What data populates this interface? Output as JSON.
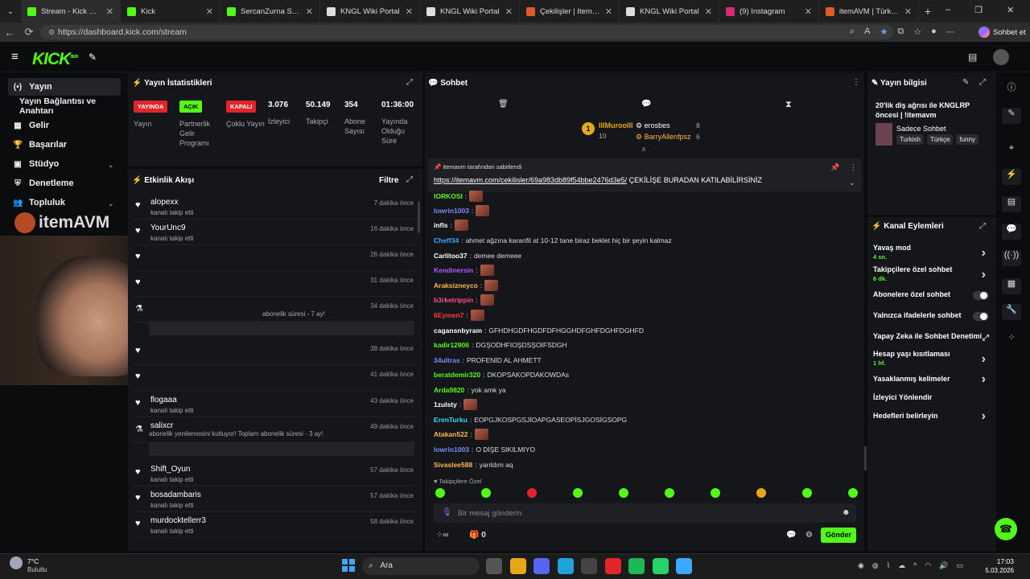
{
  "browser": {
    "tabs": [
      {
        "title": "Stream - Kick Dashboar",
        "color": "#53fc18"
      },
      {
        "title": "Kick",
        "color": "#53fc18"
      },
      {
        "title": "SercanZurna Stream - W",
        "color": "#53fc18"
      },
      {
        "title": "KNGL Wiki Portal",
        "color": "#dddddd"
      },
      {
        "title": "KNGL Wiki Portal",
        "color": "#dddddd"
      },
      {
        "title": "Çekilişler | ItemAVM",
        "color": "#e05a2b"
      },
      {
        "title": "KNGL Wiki Portal",
        "color": "#dddddd"
      },
      {
        "title": "(9) Instagram",
        "color": "#d62976"
      },
      {
        "title": "itemAVM | Türkiye'nin #",
        "color": "#e05a2b"
      }
    ],
    "url": "https://dashboard.kick.com/stream",
    "profile_label": "Sohbet et"
  },
  "header": {
    "logo": "KICK",
    "beta": "BETA"
  },
  "sidebar": {
    "items": [
      {
        "label": "Yayın",
        "icon": "(•)"
      },
      {
        "label": "Yayın Bağlantısı ve Anahtarı",
        "icon": ""
      },
      {
        "label": "Gelir",
        "icon": "▦"
      },
      {
        "label": "Başarılar",
        "icon": "🏆"
      },
      {
        "label": "Stüdyo",
        "icon": "▣"
      },
      {
        "label": "Denetleme",
        "icon": "⛨"
      },
      {
        "label": "Topluluk",
        "icon": "👥"
      }
    ],
    "overlay_text": "itemAVM"
  },
  "stats": {
    "title": "Yayın İstatistikleri",
    "badges": [
      {
        "badge": "YAYINDA",
        "label": "Yayın",
        "color": "#e0262a"
      },
      {
        "badge": "AÇIK",
        "label": "Partnerlik Gelir Programı",
        "color": "#53fc18"
      },
      {
        "badge": "KAPALI",
        "label": "Çoklu Yayın",
        "color": "#e0262a"
      }
    ],
    "values": [
      {
        "value": "3.076",
        "label": "İzleyici"
      },
      {
        "value": "50.149",
        "label": "Takipçi"
      },
      {
        "value": "354",
        "label": "Abone Sayısı"
      },
      {
        "value": "01:36:00",
        "label": "Yayında Olduğu Süre"
      }
    ]
  },
  "activity": {
    "title": "Etkinlik Akışı",
    "filter": "Filtre",
    "items": [
      {
        "name": "alopexx",
        "sub": "kanalı takip etti",
        "time": "7 dakika önce"
      },
      {
        "name": "YourUnc9",
        "sub": "kanalı takip etti",
        "time": "16 dakika önce"
      },
      {
        "name": "",
        "sub": "",
        "time": "26 dakika önce"
      },
      {
        "name": "",
        "sub": "",
        "time": "31 dakika önce"
      },
      {
        "name": "",
        "sub": "abonelik süresi - 7 ay!",
        "time": "34 dakika önce"
      },
      {
        "name": "",
        "sub": "",
        "time": "38 dakika önce"
      },
      {
        "name": "",
        "sub": "",
        "time": "41 dakika önce"
      },
      {
        "name": "flogaaa",
        "sub": "kanalı takip etti",
        "time": "43 dakika önce"
      },
      {
        "name": "salixcr",
        "sub": "abonelik yenilemesini kutluyor! Toplam abonelik süresi - 3 ay!",
        "time": "49 dakika önce"
      },
      {
        "name": "Shift_Oyun",
        "sub": "kanalı takip etti",
        "time": "57 dakika önce"
      },
      {
        "name": "bosadambaris",
        "sub": "kanalı takip etti",
        "time": "57 dakika önce"
      },
      {
        "name": "murdocktellerr3",
        "sub": "kanalı takip etti",
        "time": "58 dakika önce"
      }
    ]
  },
  "chat": {
    "title": "Sohbet",
    "top": [
      {
        "rank": "1",
        "name": "lIlMuroolll",
        "count": "10"
      },
      {
        "name": "erosbes",
        "count": "8"
      },
      {
        "name": "BarryAllenfpsz",
        "count": "6"
      }
    ],
    "pinned_by": "itemavm tarafından sabitlendi",
    "pinned_link": "https://itemavm.com/cekilisler/69a983db89f54bbe2476d3e5/",
    "pinned_text": "ÇEKİLİŞE BURADAN KATILABİLİRSİNİZ",
    "messages": [
      {
        "user": "IORKOSI",
        "color": "#53fc18",
        "text": "",
        "emote": true
      },
      {
        "user": "lowrin1003",
        "color": "#7b8cff",
        "text": "",
        "emote": true
      },
      {
        "user": "infls",
        "color": "#ffffff",
        "text": "",
        "emote": true
      },
      {
        "user": "Cheff34",
        "color": "#3aa9ff",
        "text": "ahmet ağzına karanfil at 10-12 tane biraz beklet hiç bir şeyin kalmaz",
        "emote": false
      },
      {
        "user": "Carlitoo37",
        "color": "#ffffff",
        "text": "demee demeee",
        "emote": false
      },
      {
        "user": "Kendinersin",
        "color": "#b05bff",
        "text": "",
        "emote": true
      },
      {
        "user": "Araksizneyco",
        "color": "#ffb84d",
        "text": "",
        "emote": true
      },
      {
        "user": "b3rketrippin",
        "color": "#ff4d8d",
        "text": "",
        "emote": true
      },
      {
        "user": "6Eymen7",
        "color": "#ff3b3b",
        "text": "",
        "emote": true
      },
      {
        "user": "cagansnbyram",
        "color": "#ffffff",
        "text": "GFHDHGDFHGDFDFHGGHDFGHFDGHFDGHFD",
        "emote": false
      },
      {
        "user": "kadir12906",
        "color": "#53fc18",
        "text": "DGŞODHFIOŞDSŞOIFSDGH",
        "emote": false
      },
      {
        "user": "34ultras",
        "color": "#7b8cff",
        "text": "PROFENİD AL AHMETT",
        "emote": false
      },
      {
        "user": "beratdemir320",
        "color": "#53fc18",
        "text": "DKOPSAKOPDAKOWDAs",
        "emote": false
      },
      {
        "user": "Arda9820",
        "color": "#53fc18",
        "text": "yok amk ya",
        "emote": false
      },
      {
        "user": "1zulsty",
        "color": "#ffffff",
        "text": "",
        "emote": true
      },
      {
        "user": "ErenTurku",
        "color": "#3ad6ff",
        "text": "EOPGJKOSPGSJİOAPGASEOPİSJGOSİGSOPG",
        "emote": false
      },
      {
        "user": "Atakan522",
        "color": "#ffb84d",
        "text": "",
        "emote": true
      },
      {
        "user": "lowrin1003",
        "color": "#7b8cff",
        "text": "O DİŞE SIKILMIYO",
        "emote": false
      },
      {
        "user": "Sivaslee588",
        "color": "#ffb84d",
        "text": "yarıldım aq",
        "emote": false
      }
    ],
    "followers_only": "Takipçilere Özel",
    "input_placeholder": "Bir mesaj gönderin",
    "send": "Gönder",
    "points": "0"
  },
  "info": {
    "title": "Yayın bilgisi",
    "stream_title": "20'lik diş ağrısı ile KNGLRP öncesi | !itemavm",
    "category": "Sadece Sohbet",
    "tags": [
      "Turkish",
      "Türkçe",
      "funny"
    ]
  },
  "actions": {
    "title": "Kanal Eylemleri",
    "items": [
      {
        "label": "Yavaş mod",
        "sub": "4 sn.",
        "kind": "chev"
      },
      {
        "label": "Takipçilere özel sohbet",
        "sub": "6 dk.",
        "kind": "chev"
      },
      {
        "label": "Abonelere özel sohbet",
        "sub": "",
        "kind": "toggle"
      },
      {
        "label": "Yalnızca ifadelerle sohbet",
        "sub": "",
        "kind": "toggle"
      },
      {
        "label": "Yapay Zeka ile Sohbet Denetimi",
        "sub": "",
        "kind": "ext"
      },
      {
        "label": "Hesap yaşı kısıtlaması",
        "sub": "1 hf.",
        "kind": "chev"
      },
      {
        "label": "Yasaklanmış kelimeler",
        "sub": "",
        "kind": "chev"
      },
      {
        "label": "İzleyici Yönlendir",
        "sub": "",
        "kind": "none"
      },
      {
        "label": "Hedefleri belirleyin",
        "sub": "",
        "kind": "chev"
      }
    ]
  },
  "taskbar": {
    "weather_temp": "7°C",
    "weather_text": "Bulutlu",
    "search": "Ara",
    "time": "17:03",
    "date": "5.03.2026"
  }
}
